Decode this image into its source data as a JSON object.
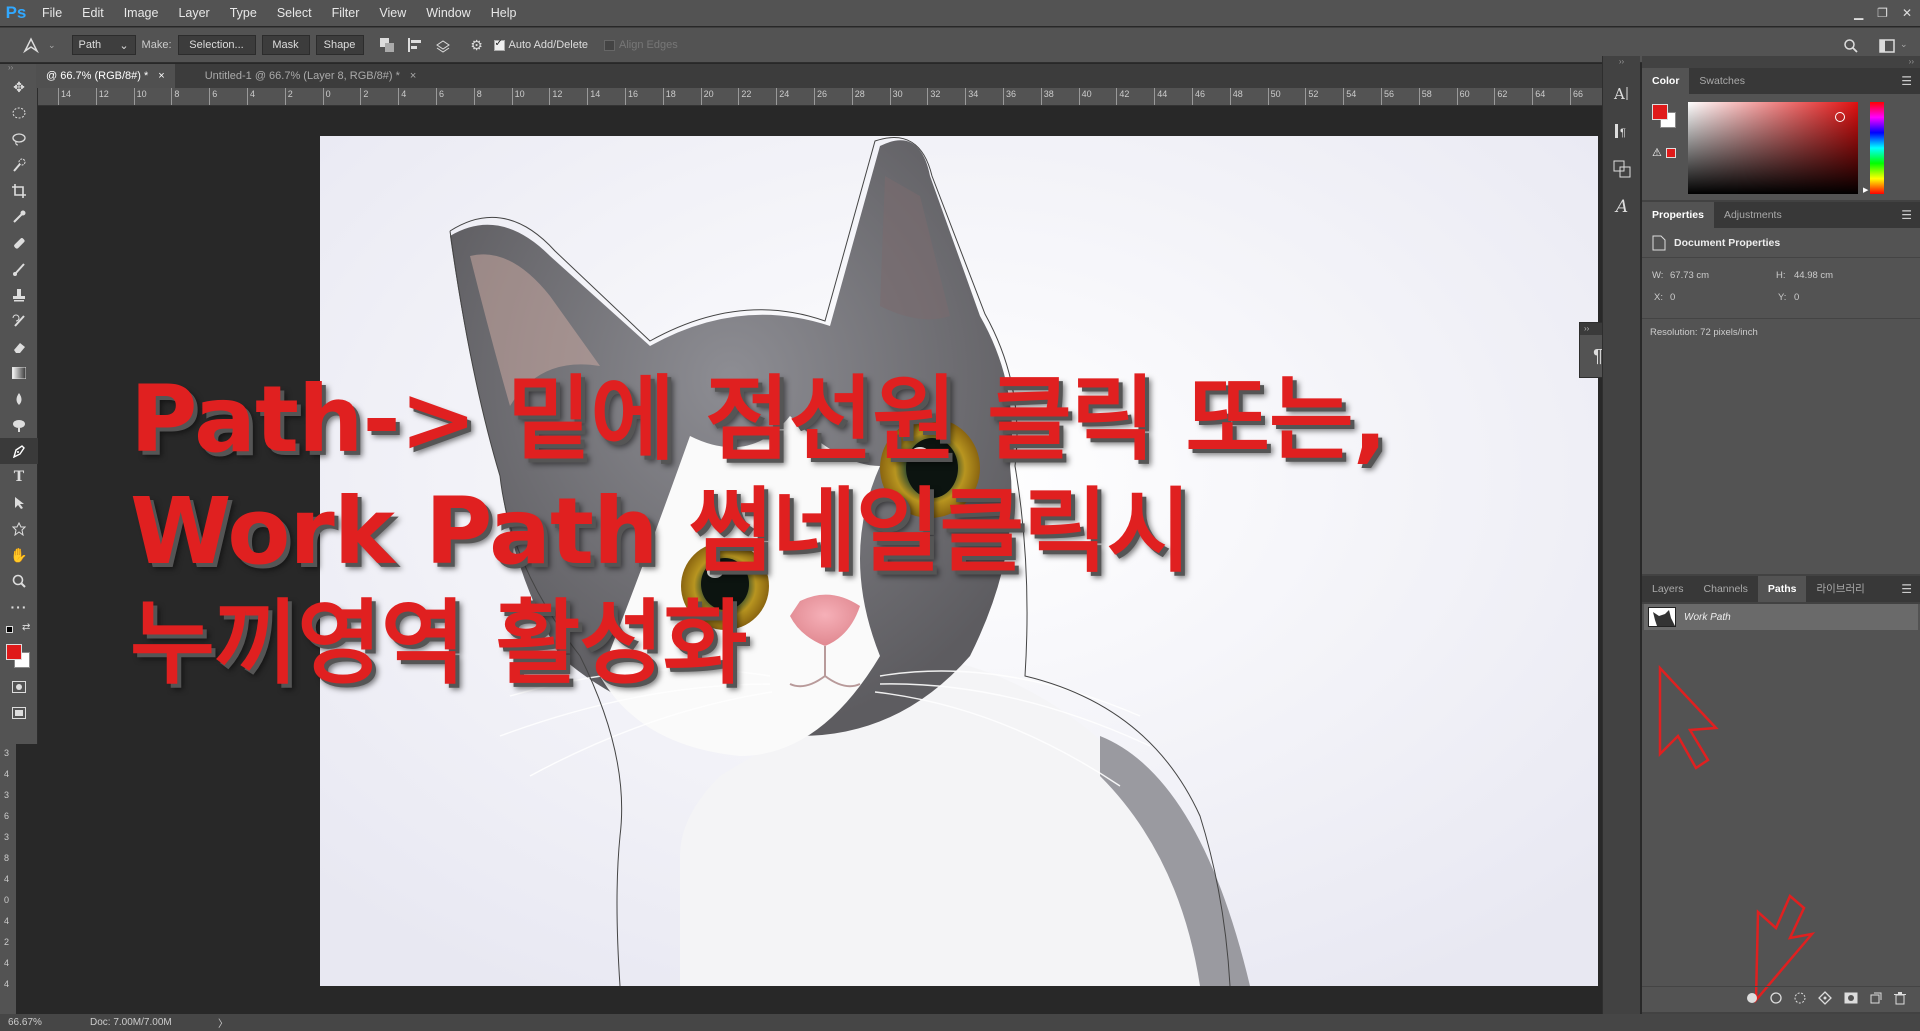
{
  "app": {
    "logo": "Ps"
  },
  "menu": [
    "File",
    "Edit",
    "Image",
    "Layer",
    "Type",
    "Select",
    "Filter",
    "View",
    "Window",
    "Help"
  ],
  "window_controls": {
    "minimize": "▁",
    "restore": "❐",
    "close": "✕"
  },
  "options": {
    "mode": "Path",
    "make_label": "Make:",
    "selection_btn": "Selection...",
    "mask_btn": "Mask",
    "shape_btn": "Shape",
    "auto_add_delete": "Auto Add/Delete",
    "align_edges": "Align Edges"
  },
  "tabs": [
    {
      "label": "@ 66.7% (RGB/8#) *",
      "close": "×"
    },
    {
      "label": "Untitled-1 @ 66.7% (Layer 8, RGB/8#) *",
      "close": "×"
    }
  ],
  "ruler_labels": [
    "14",
    "12",
    "10",
    "8",
    "6",
    "4",
    "2",
    "0",
    "2",
    "4",
    "6",
    "8",
    "10",
    "12",
    "14",
    "16",
    "18",
    "20",
    "22",
    "24",
    "26",
    "28",
    "30",
    "32",
    "34",
    "36",
    "38",
    "40",
    "42",
    "44",
    "46",
    "48",
    "50",
    "52",
    "54",
    "56",
    "58",
    "60",
    "62",
    "64",
    "66"
  ],
  "vruler_labels": [
    "3",
    "4",
    "3",
    "6",
    "3",
    "8",
    "4",
    "0",
    "4",
    "2",
    "4",
    "4"
  ],
  "overlay": {
    "line1": "Path-> 밑에 점선원 클릭 또는,",
    "line2": "Work Path 썸네일클릭시",
    "line3": "누끼영역 활성화"
  },
  "status": {
    "zoom": "66.67%",
    "doc": "Doc: 7.00M/7.00M",
    "arrow": "〉"
  },
  "color_panel": {
    "tabs": [
      "Color",
      "Swatches"
    ],
    "foreground": "#e01a1a",
    "background": "#ffffff"
  },
  "properties_panel": {
    "tabs": [
      "Properties",
      "Adjustments"
    ],
    "title": "Document Properties",
    "w_label": "W:",
    "w_value": "67.73 cm",
    "h_label": "H:",
    "h_value": "44.98 cm",
    "x_label": "X:",
    "x_value": "0",
    "y_label": "Y:",
    "y_value": "0",
    "resolution": "Resolution: 72 pixels/inch"
  },
  "layers_panel": {
    "tabs": [
      "Layers",
      "Channels",
      "Paths",
      "라이브러리"
    ],
    "work_path": "Work Path"
  },
  "paragraph_icon": "¶",
  "accent": "#e02020"
}
